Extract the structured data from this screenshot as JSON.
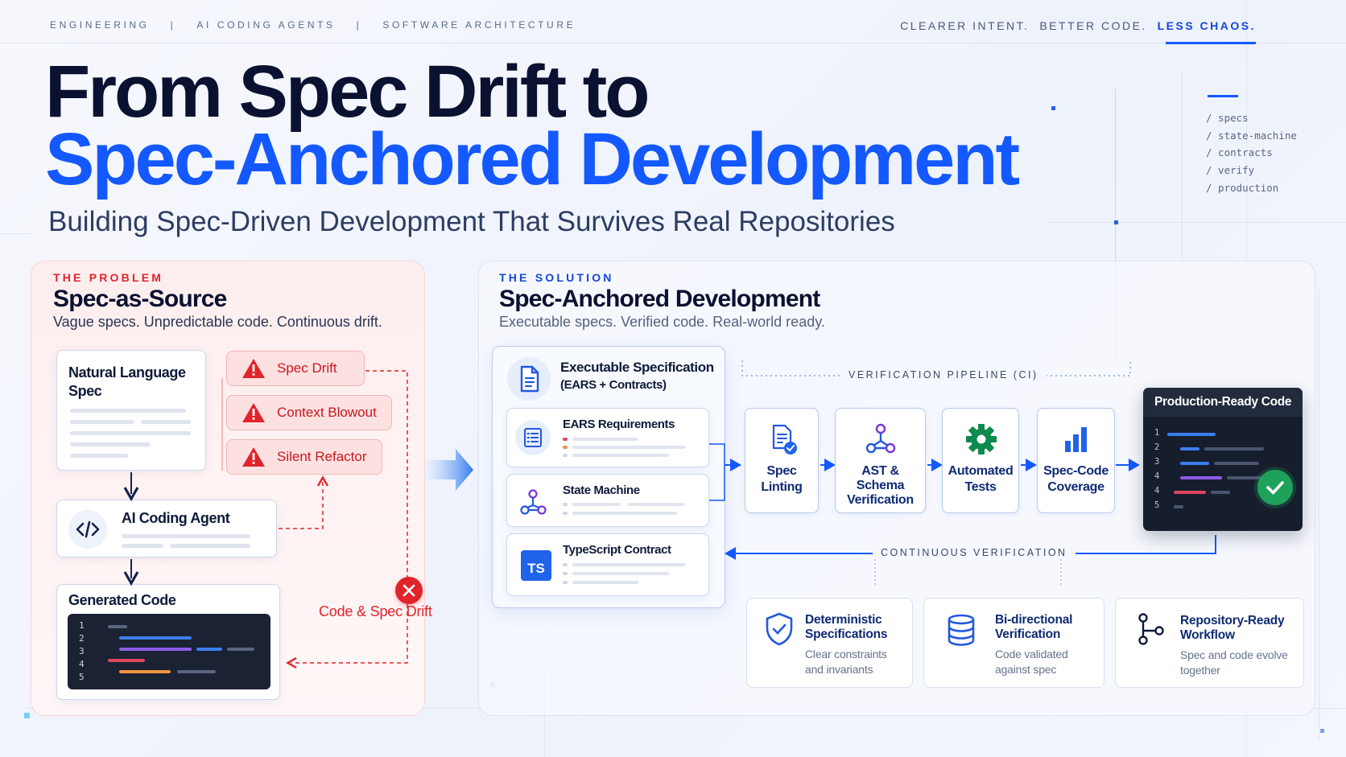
{
  "topnav": {
    "item1": "ENGINEERING",
    "sep": "|",
    "item2": "AI CODING AGENTS",
    "item3": "SOFTWARE ARCHITECTURE"
  },
  "tagline": {
    "part1": "CLEARER INTENT.",
    "part2": "BETTER CODE.",
    "part3": "LESS CHAOS."
  },
  "title": {
    "line1": "From Spec Drift to",
    "line2": "Spec-Anchored Development"
  },
  "subtitle": "Building Spec-Driven Development That Survives Real Repositories",
  "side_nav": [
    "/ specs",
    "/ state-machine",
    "/ contracts",
    "/ verify",
    "/ production"
  ],
  "problem": {
    "eyebrow": "THE PROBLEM",
    "title": "Spec-as-Source",
    "desc": "Vague specs. Unpredictable code. Continuous drift.",
    "nl_spec": "Natural Language Spec",
    "agent": "AI Coding Agent",
    "generated": "Generated Code",
    "code_lines": [
      "1",
      "2",
      "3",
      "4",
      "5"
    ],
    "issues": [
      "Spec Drift",
      "Context Blowout",
      "Silent Refactor"
    ],
    "drift_label": "Code & Spec Drift"
  },
  "solution": {
    "eyebrow": "THE SOLUTION",
    "title": "Spec-Anchored Development",
    "desc": "Executable specs. Verified code. Real-world ready.",
    "exec_spec_title": "Executable Specification",
    "exec_spec_sub": "(EARS + Contracts)",
    "components": [
      "EARS Requirements",
      "State Machine",
      "TypeScript Contract"
    ],
    "ts_badge": "TS",
    "pipeline_label": "VERIFICATION PIPELINE (CI)",
    "steps": [
      {
        "l1": "Spec",
        "l2": "Linting",
        "l3": ""
      },
      {
        "l1": "AST &",
        "l2": "Schema",
        "l3": "Verification"
      },
      {
        "l1": "Automated",
        "l2": "Tests",
        "l3": ""
      },
      {
        "l1": "Spec-Code",
        "l2": "Coverage",
        "l3": ""
      }
    ],
    "production_title": "Production-Ready Code",
    "prod_lines": [
      "1",
      "2",
      "3",
      "4",
      "4",
      "5"
    ],
    "continuous_label": "CONTINUOUS VERIFICATION",
    "features": [
      {
        "t1": "Deterministic",
        "t2": "Specifications",
        "d1": "Clear constraints",
        "d2": "and invariants"
      },
      {
        "t1": "Bi-directional",
        "t2": "Verification",
        "d1": "Code validated",
        "d2": "against spec"
      },
      {
        "t1": "Repository-Ready",
        "t2": "Workflow",
        "d1": "Spec and code evolve",
        "d2": "together"
      }
    ]
  },
  "colors": {
    "accent": "#1459ff",
    "navy": "#0b1130",
    "danger": "#e0242b",
    "success": "#1fa15b",
    "dark_code": "#1b2233"
  },
  "icons": [
    "document-icon",
    "checklist-icon",
    "state-machine-icon",
    "ts-badge-icon",
    "document-check-icon",
    "branch-nodes-icon",
    "gear-icon",
    "bar-chart-icon",
    "shield-check-icon",
    "database-icon",
    "git-branch-icon",
    "warning-icon",
    "code-icon",
    "close-circle-icon",
    "check-circle-icon"
  ]
}
